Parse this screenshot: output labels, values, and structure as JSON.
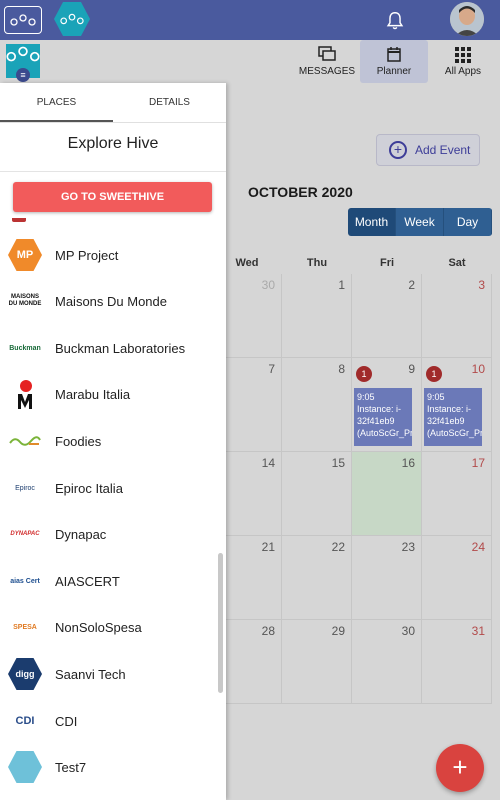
{
  "topbar": {
    "notification_icon": "bell-icon",
    "avatar": "user-avatar"
  },
  "nav": {
    "messages_label": "MESSAGES",
    "planner_label": "Planner",
    "apps_label": "All Apps"
  },
  "calendar": {
    "add_event_label": "Add Event",
    "month_title": "OCTOBER 2020",
    "views": [
      "Month",
      "Week",
      "Day"
    ],
    "day_headers": [
      "Wed",
      "Thu",
      "Fri",
      "Sat"
    ],
    "weeks": [
      [
        "30",
        "1",
        "2",
        "3"
      ],
      [
        "7",
        "8",
        "9",
        "10"
      ],
      [
        "14",
        "15",
        "16",
        "17"
      ],
      [
        "21",
        "22",
        "23",
        "24"
      ],
      [
        "28",
        "29",
        "30",
        "31"
      ]
    ],
    "badge_fri": "1",
    "badge_sat": "1",
    "event_fri": "9:05 Instance: i-32f41eb9 (AutoScGr_Pr",
    "event_sat": "9:05 Instance: i-32f41eb9 (AutoScGr_Pr",
    "fab_label": "+"
  },
  "panel": {
    "tab_places": "PLACES",
    "tab_details": "DETAILS",
    "title": "Explore Hive",
    "sweethive_button": "GO TO SWEETHIVE",
    "places": [
      "MP Project",
      "Maisons Du Monde",
      "Buckman Laboratories",
      "Marabu Italia",
      "Foodies",
      "Epiroc Italia",
      "Dynapac",
      "AIASCERT",
      "NonSoloSpesa",
      "Saanvi Tech",
      "CDI",
      "Test7"
    ],
    "logo_texts": {
      "mp": "MP",
      "maisons": "MAISONS DU MONDE",
      "buckman": "Buckman",
      "epiroc": "Epiroc",
      "dynapac": "DYNAPAC",
      "aias": "aias Cert",
      "spesa": "SPESA",
      "digg": "digg",
      "cdi": "CDI"
    }
  }
}
